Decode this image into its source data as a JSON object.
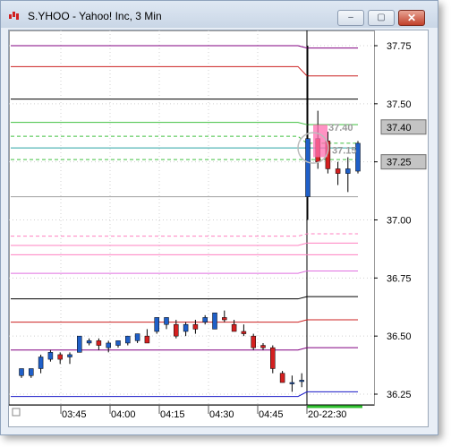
{
  "window": {
    "title": "S.YHOO - Yahoo! Inc, 3 Min",
    "buttons": {
      "minimize": "–",
      "maximize": "▢",
      "close": "✕"
    }
  },
  "colors": {
    "up_candle": "#1f5fc8",
    "down_candle": "#d42020",
    "current_price_line": "#2aa3a3",
    "grid": "#d0d0d0",
    "price_box_fill": "#c4c4c4"
  },
  "chart_data": {
    "type": "candlestick",
    "interval": "3 Min",
    "ylim": [
      36.2,
      37.8
    ],
    "y_ticks": [
      "37.75",
      "37.50",
      "37.25",
      "37.00",
      "36.75",
      "36.50",
      "36.25"
    ],
    "x_ticks": [
      "03:45",
      "04:00",
      "04:15",
      "04:30",
      "04:45",
      "20-22:30"
    ],
    "price_markers": [
      {
        "value": "37.40",
        "price": 37.4
      },
      {
        "value": "37.25",
        "price": 37.25
      }
    ],
    "annotations": [
      {
        "text": "37.40",
        "price": 37.4
      },
      {
        "text": "37.15",
        "price": 37.3
      }
    ],
    "levels": [
      {
        "color": "#800080",
        "before": 37.75,
        "after": 37.74,
        "dashed": false
      },
      {
        "color": "#cc2020",
        "before": 37.66,
        "after": 37.62,
        "dashed": false
      },
      {
        "color": "#000000",
        "before": 37.52,
        "after": 37.52,
        "dashed": false
      },
      {
        "color": "#40c040",
        "before": 37.42,
        "after": 37.41,
        "dashed": false
      },
      {
        "color": "#40c040",
        "before": 37.36,
        "after": 37.33,
        "dashed": true
      },
      {
        "color": "#2aa3a3",
        "before": 37.31,
        "after": 37.31,
        "dashed": false
      },
      {
        "color": "#40c040",
        "before": 37.26,
        "after": 37.26,
        "dashed": true
      },
      {
        "color": "#a0a0a0",
        "before": 37.1,
        "after": 37.1,
        "dashed": false
      },
      {
        "color": "#ff80c0",
        "before": 36.93,
        "after": 36.94,
        "dashed": true
      },
      {
        "color": "#ff80c0",
        "before": 36.89,
        "after": 36.9,
        "dashed": false
      },
      {
        "color": "#ff80c0",
        "before": 36.85,
        "after": 36.85,
        "dashed": false
      },
      {
        "color": "#e070e0",
        "before": 36.77,
        "after": 36.78,
        "dashed": false
      },
      {
        "color": "#000000",
        "before": 36.66,
        "after": 36.67,
        "dashed": false
      },
      {
        "color": "#cc2020",
        "before": 36.56,
        "after": 36.57,
        "dashed": false
      },
      {
        "color": "#800080",
        "before": 36.44,
        "after": 36.45,
        "dashed": false
      },
      {
        "color": "#1818c8",
        "before": 36.24,
        "after": 36.26,
        "dashed": false
      }
    ],
    "session1": [
      {
        "o": 36.33,
        "h": 36.36,
        "l": 36.32,
        "c": 36.36
      },
      {
        "o": 36.33,
        "h": 36.36,
        "l": 36.32,
        "c": 36.36
      },
      {
        "o": 36.36,
        "h": 36.42,
        "l": 36.34,
        "c": 36.41
      },
      {
        "o": 36.4,
        "h": 36.44,
        "l": 36.39,
        "c": 36.43
      },
      {
        "o": 36.42,
        "h": 36.43,
        "l": 36.38,
        "c": 36.4
      },
      {
        "o": 36.41,
        "h": 36.43,
        "l": 36.38,
        "c": 36.42
      },
      {
        "o": 36.43,
        "h": 36.5,
        "l": 36.43,
        "c": 36.5
      },
      {
        "o": 36.47,
        "h": 36.49,
        "l": 36.46,
        "c": 36.48
      },
      {
        "o": 36.48,
        "h": 36.49,
        "l": 36.44,
        "c": 36.46
      },
      {
        "o": 36.45,
        "h": 36.48,
        "l": 36.43,
        "c": 36.47
      },
      {
        "o": 36.46,
        "h": 36.48,
        "l": 36.45,
        "c": 36.48
      },
      {
        "o": 36.47,
        "h": 36.5,
        "l": 36.46,
        "c": 36.5
      },
      {
        "o": 36.48,
        "h": 36.51,
        "l": 36.47,
        "c": 36.51
      },
      {
        "o": 36.5,
        "h": 36.53,
        "l": 36.47,
        "c": 36.47
      },
      {
        "o": 36.52,
        "h": 36.58,
        "l": 36.51,
        "c": 36.58
      },
      {
        "o": 36.55,
        "h": 36.58,
        "l": 36.53,
        "c": 36.58
      },
      {
        "o": 36.55,
        "h": 36.57,
        "l": 36.49,
        "c": 36.5
      },
      {
        "o": 36.52,
        "h": 36.56,
        "l": 36.5,
        "c": 36.55
      },
      {
        "o": 36.55,
        "h": 36.57,
        "l": 36.51,
        "c": 36.53
      },
      {
        "o": 36.56,
        "h": 36.59,
        "l": 36.55,
        "c": 36.58
      },
      {
        "o": 36.53,
        "h": 36.6,
        "l": 36.53,
        "c": 36.6
      },
      {
        "o": 36.58,
        "h": 36.61,
        "l": 36.56,
        "c": 36.57
      },
      {
        "o": 36.55,
        "h": 36.57,
        "l": 36.52,
        "c": 36.52
      },
      {
        "o": 36.52,
        "h": 36.55,
        "l": 36.5,
        "c": 36.51
      },
      {
        "o": 36.5,
        "h": 36.51,
        "l": 36.44,
        "c": 36.45
      },
      {
        "o": 36.46,
        "h": 36.47,
        "l": 36.44,
        "c": 36.45
      },
      {
        "o": 36.45,
        "h": 36.46,
        "l": 36.34,
        "c": 36.36
      },
      {
        "o": 36.34,
        "h": 36.35,
        "l": 36.3,
        "c": 36.3
      },
      {
        "o": 36.3,
        "h": 36.33,
        "l": 36.26,
        "c": 36.3
      },
      {
        "o": 36.31,
        "h": 36.34,
        "l": 36.28,
        "c": 36.31
      }
    ],
    "session2": [
      {
        "o": 37.1,
        "h": 37.75,
        "l": 37.0,
        "c": 37.35
      },
      {
        "o": 37.35,
        "h": 37.47,
        "l": 37.22,
        "c": 37.25
      },
      {
        "o": 37.34,
        "h": 37.38,
        "l": 37.2,
        "c": 37.22
      },
      {
        "o": 37.22,
        "h": 37.25,
        "l": 37.15,
        "c": 37.2
      },
      {
        "o": 37.2,
        "h": 37.27,
        "l": 37.12,
        "c": 37.22
      },
      {
        "o": 37.21,
        "h": 37.34,
        "l": 37.2,
        "c": 37.33
      }
    ]
  }
}
